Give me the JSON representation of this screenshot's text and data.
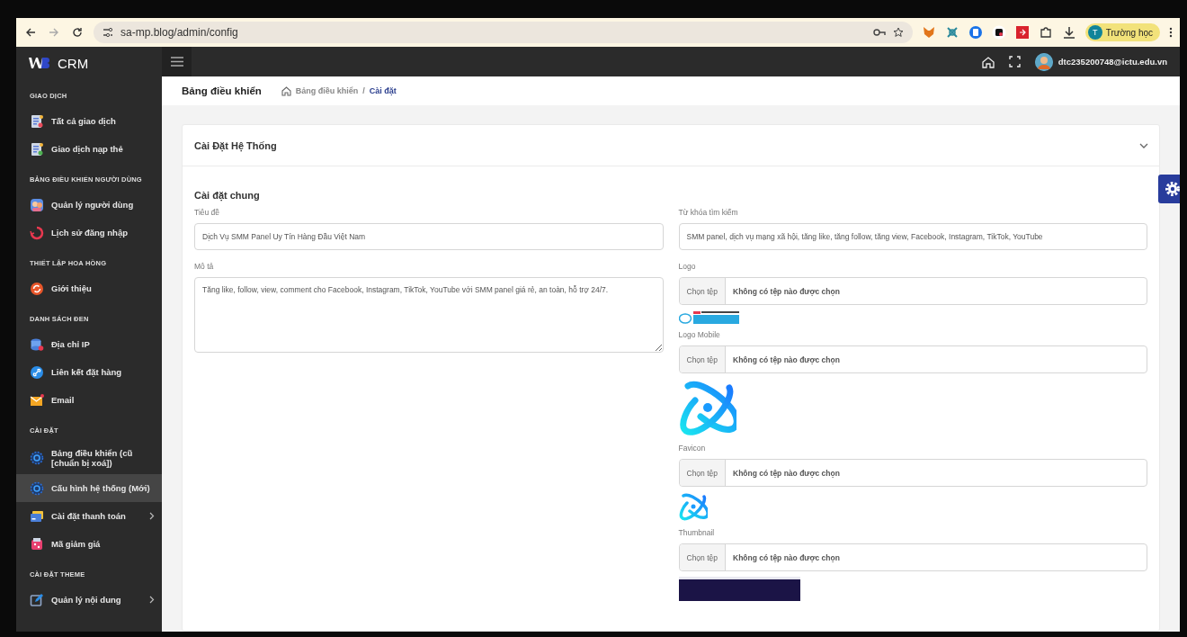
{
  "browser": {
    "url": "sa-mp.blog/admin/config",
    "profile_initial": "T",
    "profile_name": "Trường học"
  },
  "brand": {
    "name": "CRM"
  },
  "topbar": {
    "user_email": "dtc235200748@ictu.edu.vn"
  },
  "page_header": {
    "title": "Bảng điều khiển",
    "breadcrumb": [
      {
        "label": "Bảng điều khiển",
        "selected": false
      },
      {
        "label": "/",
        "selected": false
      },
      {
        "label": "Cài đặt",
        "selected": true
      }
    ]
  },
  "sidebar": {
    "sections": [
      {
        "title": "GIAO DỊCH",
        "items": [
          {
            "label": "Tất cả giao dịch",
            "selected": false,
            "has_submenu": false
          },
          {
            "label": "Giao dịch nạp thẻ",
            "selected": false,
            "has_submenu": false
          }
        ]
      },
      {
        "title": "BẢNG ĐIỀU KHIỂN NGƯỜI DÙNG",
        "items": [
          {
            "label": "Quản lý người dùng",
            "selected": false,
            "has_submenu": false
          },
          {
            "label": "Lịch sử đăng nhập",
            "selected": false,
            "has_submenu": false
          }
        ]
      },
      {
        "title": "THIẾT LẬP HOA HỒNG",
        "items": [
          {
            "label": "Giới thiệu",
            "selected": false,
            "has_submenu": false
          }
        ]
      },
      {
        "title": "DANH SÁCH ĐEN",
        "items": [
          {
            "label": "Địa chỉ IP",
            "selected": false,
            "has_submenu": false
          },
          {
            "label": "Liên kết đặt hàng",
            "selected": false,
            "has_submenu": false
          },
          {
            "label": "Email",
            "selected": false,
            "has_submenu": false
          }
        ]
      },
      {
        "title": "CÀI ĐẶT",
        "items": [
          {
            "label": "Bảng điều khiển (cũ [chuẩn bị xoá])",
            "selected": false,
            "has_submenu": false
          },
          {
            "label": "Cấu hình hệ thống (Mới)",
            "selected": true,
            "has_submenu": false
          },
          {
            "label": "Cài đặt thanh toán",
            "selected": false,
            "has_submenu": true
          },
          {
            "label": "Mã giảm giá",
            "selected": false,
            "has_submenu": false
          }
        ]
      },
      {
        "title": "CÀI ĐẶT THEME",
        "items": [
          {
            "label": "Quản lý nội dung",
            "selected": false,
            "has_submenu": true
          }
        ]
      }
    ]
  },
  "card": {
    "title": "Cài Đặt Hệ Thống",
    "expanded": true,
    "section_title": "Cài đặt chung",
    "left_fields": [
      {
        "kind": "text",
        "label": "Tiêu đề",
        "value": "Dịch Vụ SMM Panel Uy Tín Hàng Đầu Việt Nam"
      },
      {
        "kind": "textarea",
        "label": "Mô tả",
        "value": "Tăng like, follow, view, comment cho Facebook, Instagram, TikTok, YouTube với SMM panel giá rẻ, an toàn, hỗ trợ 24/7."
      }
    ],
    "right_fields": [
      {
        "kind": "text",
        "label": "Từ khóa tìm kiếm",
        "value": "SMM panel, dịch vụ mạng xã hội, tăng like, tăng follow, tăng view, Facebook, Instagram, TikTok, YouTube"
      },
      {
        "kind": "file",
        "label": "Logo",
        "button": "Chọn tệp",
        "status": "Không có tệp nào được chọn",
        "preview": {
          "kind": "wide"
        }
      },
      {
        "kind": "file",
        "label": "Logo Mobile",
        "button": "Chọn tệp",
        "status": "Không có tệp nào được chọn",
        "preview": {
          "kind": "mark-large"
        }
      },
      {
        "kind": "file",
        "label": "Favicon",
        "button": "Chọn tệp",
        "status": "Không có tệp nào được chọn",
        "preview": {
          "kind": "mark-small"
        }
      },
      {
        "kind": "file",
        "label": "Thumbnail",
        "button": "Chọn tệp",
        "status": "Không có tệp nào được chọn",
        "preview": {
          "kind": "screenshot"
        }
      }
    ]
  }
}
